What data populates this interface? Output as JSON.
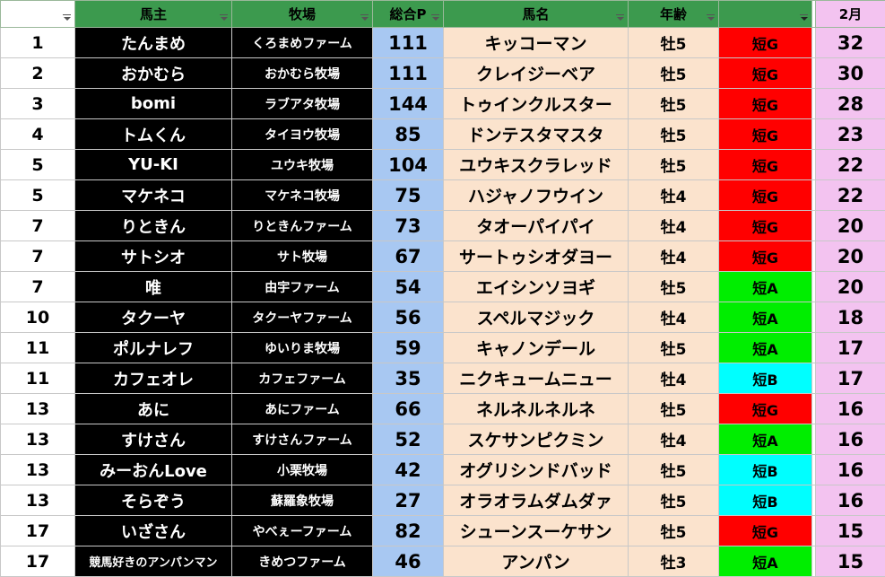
{
  "header": {
    "rank": "",
    "owner": "馬主",
    "farm": "牧場",
    "points": "総合P",
    "horse": "馬名",
    "age": "年齢",
    "grade": "",
    "month": "2月"
  },
  "colors": {
    "G": "#ff0000",
    "A": "#00ee00",
    "B": "#00ffff"
  },
  "rows": [
    {
      "rank": "1",
      "owner": "たんまめ",
      "farm": "くろまめファーム",
      "points": "111",
      "horse": "キッコーマン",
      "age": "牡5",
      "grade": "短G",
      "g": "G",
      "month": "32"
    },
    {
      "rank": "2",
      "owner": "おかむら",
      "farm": "おかむら牧場",
      "points": "111",
      "horse": "クレイジーベア",
      "age": "牡5",
      "grade": "短G",
      "g": "G",
      "month": "30"
    },
    {
      "rank": "3",
      "owner": "bomi",
      "farm": "ラブアタ牧場",
      "points": "144",
      "horse": "トゥインクルスター",
      "age": "牡5",
      "grade": "短G",
      "g": "G",
      "month": "28"
    },
    {
      "rank": "4",
      "owner": "トムくん",
      "farm": "タイヨウ牧場",
      "points": "85",
      "horse": "ドンテスタマスタ",
      "age": "牡5",
      "grade": "短G",
      "g": "G",
      "month": "23"
    },
    {
      "rank": "5",
      "owner": "YU-KI",
      "farm": "ユウキ牧場",
      "points": "104",
      "horse": "ユウキスクラレッド",
      "age": "牡5",
      "grade": "短G",
      "g": "G",
      "month": "22"
    },
    {
      "rank": "5",
      "owner": "マケネコ",
      "farm": "マケネコ牧場",
      "points": "75",
      "horse": "ハジャノフウイン",
      "age": "牡4",
      "grade": "短G",
      "g": "G",
      "month": "22"
    },
    {
      "rank": "7",
      "owner": "りときん",
      "farm": "りときんファーム",
      "points": "73",
      "horse": "タオーパイパイ",
      "age": "牡4",
      "grade": "短G",
      "g": "G",
      "month": "20"
    },
    {
      "rank": "7",
      "owner": "サトシオ",
      "farm": "サト牧場",
      "points": "67",
      "horse": "サートゥシオダヨー",
      "age": "牡4",
      "grade": "短G",
      "g": "G",
      "month": "20"
    },
    {
      "rank": "7",
      "owner": "唯",
      "farm": "由宇ファーム",
      "points": "54",
      "horse": "エイシンソヨギ",
      "age": "牡5",
      "grade": "短A",
      "g": "A",
      "month": "20"
    },
    {
      "rank": "10",
      "owner": "タクーヤ",
      "farm": "タクーヤファーム",
      "points": "56",
      "horse": "スペルマジック",
      "age": "牡4",
      "grade": "短A",
      "g": "A",
      "month": "18"
    },
    {
      "rank": "11",
      "owner": "ポルナレフ",
      "farm": "ゆいりま牧場",
      "points": "59",
      "horse": "キャノンデール",
      "age": "牡5",
      "grade": "短A",
      "g": "A",
      "month": "17"
    },
    {
      "rank": "11",
      "owner": "カフェオレ",
      "farm": "カフェファーム",
      "points": "35",
      "horse": "ニクキュームニュー",
      "age": "牡4",
      "grade": "短B",
      "g": "B",
      "month": "17"
    },
    {
      "rank": "13",
      "owner": "あに",
      "farm": "あにファーム",
      "points": "66",
      "horse": "ネルネルネルネ",
      "age": "牡5",
      "grade": "短G",
      "g": "G",
      "month": "16"
    },
    {
      "rank": "13",
      "owner": "すけさん",
      "farm": "すけさんファーム",
      "points": "52",
      "horse": "スケサンピクミン",
      "age": "牡4",
      "grade": "短A",
      "g": "A",
      "month": "16"
    },
    {
      "rank": "13",
      "owner": "みーおんLove",
      "farm": "小栗牧場",
      "points": "42",
      "horse": "オグリシンドバッド",
      "age": "牡5",
      "grade": "短B",
      "g": "B",
      "month": "16"
    },
    {
      "rank": "13",
      "owner": "そらぞう",
      "farm": "蘇羅象牧場",
      "points": "27",
      "horse": "オラオラムダムダァ",
      "age": "牡5",
      "grade": "短B",
      "g": "B",
      "month": "16"
    },
    {
      "rank": "17",
      "owner": "いざさん",
      "farm": "やべぇーファーム",
      "points": "82",
      "horse": "シューンスーケサン",
      "age": "牡5",
      "grade": "短G",
      "g": "G",
      "month": "15"
    },
    {
      "rank": "17",
      "owner": "競馬好きのアンパンマン",
      "farm": "きめつファーム",
      "points": "46",
      "horse": "アンパン",
      "age": "牡3",
      "grade": "短A",
      "g": "A",
      "month": "15"
    }
  ]
}
